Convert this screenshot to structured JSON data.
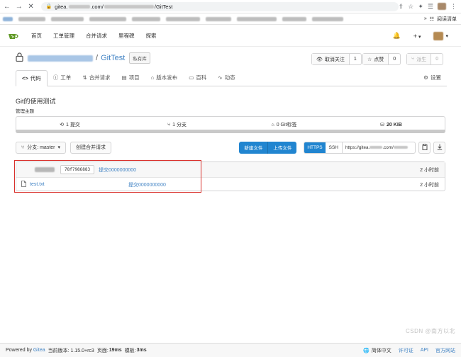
{
  "browser": {
    "url_prefix": "gitea.",
    "url_domain": ".com/",
    "url_suffix": "/GitTest",
    "reading_mode_label": "阅读清单"
  },
  "nav": {
    "items": [
      "首页",
      "工单管理",
      "合并请求",
      "里程碑",
      "探索"
    ],
    "plus_label": "+",
    "caret": "▾"
  },
  "repo": {
    "name": "GitTest",
    "separator": "/",
    "private_badge": "私有库",
    "unwatch_label": "取消关注",
    "watch_count": "1",
    "star_label": "点赞",
    "star_count": "0",
    "fork_label": "派生",
    "fork_count": "0"
  },
  "tabs": [
    {
      "label": "代码",
      "icon": "code-icon"
    },
    {
      "label": "工单",
      "icon": "issue-icon"
    },
    {
      "label": "合并请求",
      "icon": "pull-request-icon"
    },
    {
      "label": "项目",
      "icon": "project-icon"
    },
    {
      "label": "版本发布",
      "icon": "tag-icon"
    },
    {
      "label": "百科",
      "icon": "book-icon"
    },
    {
      "label": "动态",
      "icon": "pulse-icon"
    }
  ],
  "settings_label": "设置",
  "description": "Git的使用测试",
  "manage_topics": "管理主题",
  "stats": {
    "commits": "1 提交",
    "branches": "1 分支",
    "tags": "0 Git标签",
    "size": "20 KiB"
  },
  "toolbar": {
    "branch_label": "分支: master",
    "new_pr_label": "创建合并请求",
    "new_file_label": "新建文件",
    "upload_label": "上传文件",
    "https_label": "HTTPS",
    "ssh_label": "SSH",
    "clone_url_prefix": "https://gitea.",
    "clone_url_mid": ".com/"
  },
  "latest_commit": {
    "sha": "78f7986883",
    "message": "提交0000000000",
    "time": "2 小时前"
  },
  "files": [
    {
      "name": "test.txt",
      "commit": "提交0000000000",
      "time": "2 小时前"
    }
  ],
  "footer": {
    "powered_prefix": "Powered by ",
    "powered_link": "Gitea",
    "version": "当前版本: 1.15.0+rc3",
    "page_time_label": "页面:",
    "page_time": "19ms",
    "template_label": "模板:",
    "template_time": "3ms",
    "language": "简体中文",
    "license": "许可证",
    "api": "API",
    "website": "官方网站"
  },
  "watermark": "CSDN @南方以北"
}
